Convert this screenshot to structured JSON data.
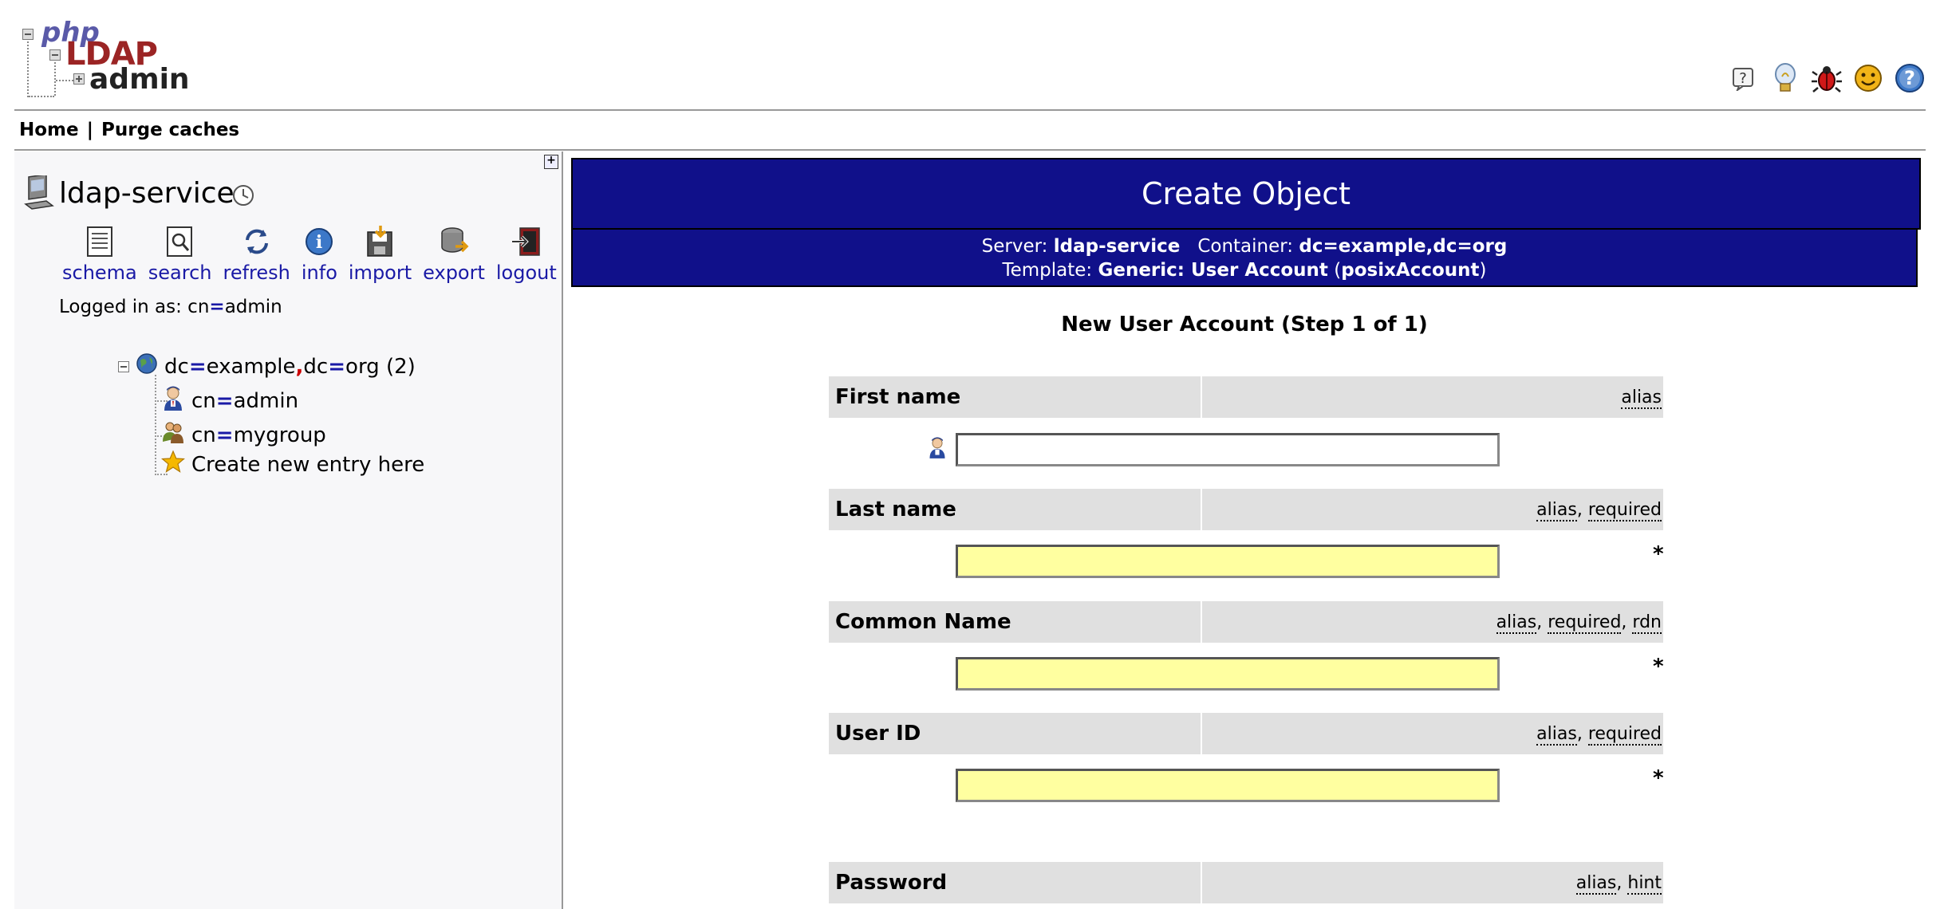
{
  "logo": {
    "php": "php",
    "ldap": "LDAP",
    "admin": "admin"
  },
  "header_icons": [
    "help-icon",
    "lightbulb-icon",
    "bug-icon",
    "smiley-icon",
    "question-icon"
  ],
  "nav": {
    "home": "Home",
    "separator": "|",
    "purge": "Purge caches"
  },
  "server": {
    "name": "ldap-service",
    "actions": [
      "schema",
      "search",
      "refresh",
      "info",
      "import",
      "export",
      "logout"
    ],
    "logged_in_prefix": "Logged in as: ",
    "logged_in_attr": "cn",
    "logged_in_eq": "=",
    "logged_in_value": "admin"
  },
  "tree": {
    "root": {
      "a1": "dc",
      "eq1": "=",
      "v1": "example",
      "comma": ",",
      "a2": "dc",
      "eq2": "=",
      "v2": "org",
      "count": " (2)"
    },
    "children": [
      {
        "attr": "cn",
        "eq": "=",
        "value": "admin"
      },
      {
        "attr": "cn",
        "eq": "=",
        "value": "mygroup"
      }
    ],
    "create": "Create new entry here"
  },
  "main": {
    "title": "Create Object",
    "server_label": "Server: ",
    "server_value": "ldap-service",
    "container_label": "Container: ",
    "container_value": "dc=example,dc=org",
    "template_label": "Template: ",
    "template_value": "Generic: User Account",
    "template_class_open": " (",
    "template_class": "posixAccount",
    "template_class_close": ")",
    "form_heading": "New User Account (Step 1 of 1)"
  },
  "fields": [
    {
      "label": "First name",
      "tags": [
        "alias"
      ],
      "required": false,
      "value": ""
    },
    {
      "label": "Last name",
      "tags": [
        "alias",
        "required"
      ],
      "required": true,
      "value": ""
    },
    {
      "label": "Common Name",
      "tags": [
        "alias",
        "required",
        "rdn"
      ],
      "required": true,
      "value": ""
    },
    {
      "label": "User ID",
      "tags": [
        "alias",
        "required"
      ],
      "required": true,
      "value": ""
    },
    {
      "label": "Password",
      "tags": [
        "alias",
        "hint"
      ],
      "required": false,
      "value": ""
    }
  ],
  "required_marker": "*",
  "colors": {
    "title_bg": "#10108a",
    "link": "#1a1aa6",
    "required_bg": "#ffffa0",
    "field_header_bg": "#e0e0e0"
  }
}
